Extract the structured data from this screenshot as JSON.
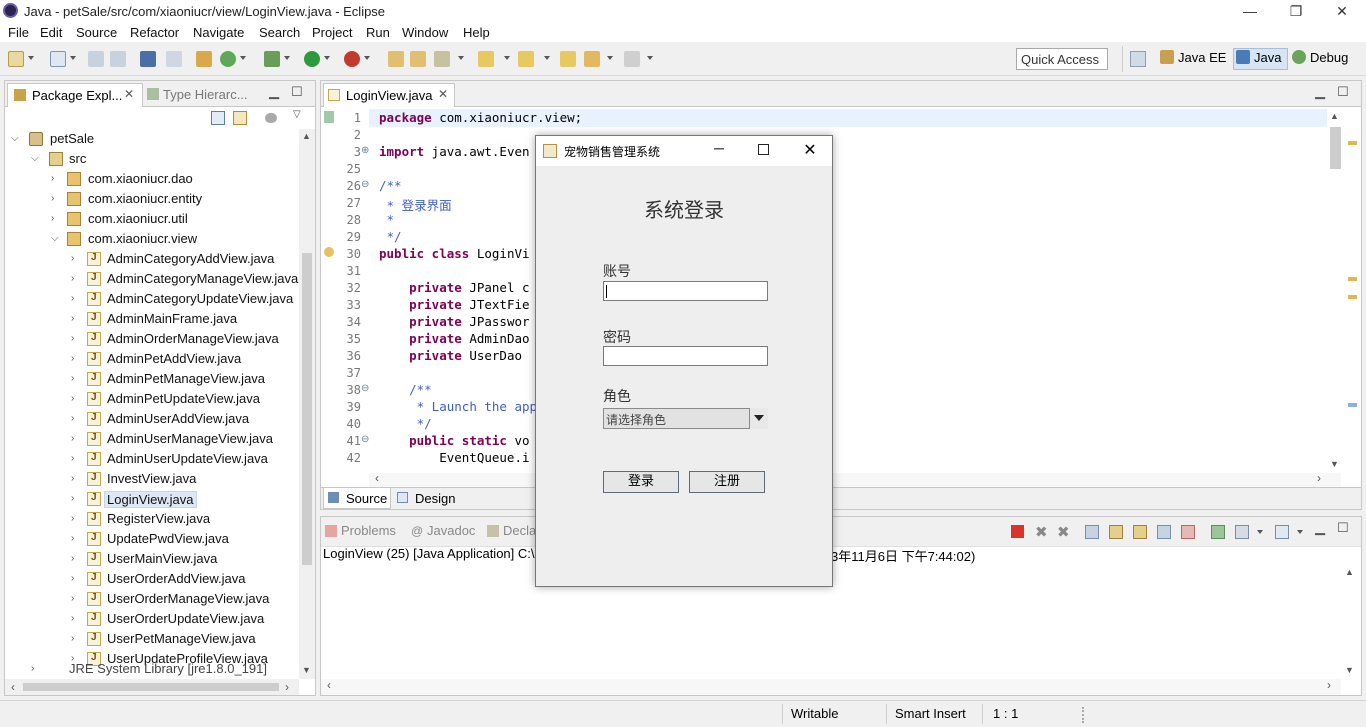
{
  "window": {
    "title": "Java - petSale/src/com/xiaoniucr/view/LoginView.java - Eclipse",
    "minimize": "—",
    "maximize": "❐",
    "close": "✕"
  },
  "menu": [
    "File",
    "Edit",
    "Source",
    "Refactor",
    "Navigate",
    "Search",
    "Project",
    "Run",
    "Window",
    "Help"
  ],
  "toolbar": {
    "quick_access": "Quick Access",
    "perspectives": [
      {
        "label": "Java EE"
      },
      {
        "label": "Java"
      },
      {
        "label": "Debug"
      }
    ]
  },
  "explorer": {
    "tab_active": "Package Expl...",
    "tab_other": "Type Hierarc...",
    "project": "petSale",
    "src": "src",
    "packages": [
      "com.xiaoniucr.dao",
      "com.xiaoniucr.entity",
      "com.xiaoniucr.util",
      "com.xiaoniucr.view"
    ],
    "files": [
      "AdminCategoryAddView.java",
      "AdminCategoryManageView.java",
      "AdminCategoryUpdateView.java",
      "AdminMainFrame.java",
      "AdminOrderManageView.java",
      "AdminPetAddView.java",
      "AdminPetManageView.java",
      "AdminPetUpdateView.java",
      "AdminUserAddView.java",
      "AdminUserManageView.java",
      "AdminUserUpdateView.java",
      "InvestView.java",
      "LoginView.java",
      "RegisterView.java",
      "UpdatePwdView.java",
      "UserMainView.java",
      "UserOrderAddView.java",
      "UserOrderManageView.java",
      "UserOrderUpdateView.java",
      "UserPetManageView.java",
      "UserUpdateProfileView.java"
    ],
    "selected_file": "LoginView.java",
    "partial_row": "JRE System Library [jre1.8.0_191]"
  },
  "editor": {
    "tab": "LoginView.java",
    "lines": [
      {
        "n": "1",
        "parts": [
          [
            "kw",
            "package"
          ],
          [
            "",
            " com.xiaoniucr.view;"
          ]
        ]
      },
      {
        "n": "2",
        "parts": []
      },
      {
        "n": "3",
        "parts": [
          [
            "kw",
            "import"
          ],
          [
            "",
            " java.awt.Even"
          ]
        ]
      },
      {
        "n": "25",
        "parts": []
      },
      {
        "n": "26",
        "parts": [
          [
            "cm",
            "/**"
          ]
        ]
      },
      {
        "n": "27",
        "parts": [
          [
            "cm",
            " * 登录界面"
          ]
        ]
      },
      {
        "n": "28",
        "parts": [
          [
            "cm",
            " *"
          ]
        ]
      },
      {
        "n": "29",
        "parts": [
          [
            "cm",
            " */"
          ]
        ]
      },
      {
        "n": "30",
        "parts": [
          [
            "kw",
            "public class"
          ],
          [
            "",
            " LoginVi"
          ]
        ]
      },
      {
        "n": "31",
        "parts": []
      },
      {
        "n": "32",
        "parts": [
          [
            "",
            "    "
          ],
          [
            "kw",
            "private"
          ],
          [
            "",
            " JPanel c"
          ]
        ]
      },
      {
        "n": "33",
        "parts": [
          [
            "",
            "    "
          ],
          [
            "kw",
            "private"
          ],
          [
            "",
            " JTextFie"
          ]
        ]
      },
      {
        "n": "34",
        "parts": [
          [
            "",
            "    "
          ],
          [
            "kw",
            "private"
          ],
          [
            "",
            " JPasswor"
          ]
        ]
      },
      {
        "n": "35",
        "parts": [
          [
            "",
            "    "
          ],
          [
            "kw",
            "private"
          ],
          [
            "",
            " AdminDao"
          ]
        ]
      },
      {
        "n": "36",
        "parts": [
          [
            "",
            "    "
          ],
          [
            "kw",
            "private"
          ],
          [
            "",
            " UserDao "
          ]
        ]
      },
      {
        "n": "37",
        "parts": []
      },
      {
        "n": "38",
        "parts": [
          [
            "",
            "    "
          ],
          [
            "cm",
            "/**"
          ]
        ]
      },
      {
        "n": "39",
        "parts": [
          [
            "",
            "    "
          ],
          [
            "cm",
            " * Launch the app"
          ]
        ]
      },
      {
        "n": "40",
        "parts": [
          [
            "",
            "    "
          ],
          [
            "cm",
            " */"
          ]
        ]
      },
      {
        "n": "41",
        "parts": [
          [
            "",
            "    "
          ],
          [
            "kw",
            "public static"
          ],
          [
            "",
            " vo"
          ]
        ]
      },
      {
        "n": "42",
        "parts": [
          [
            "",
            "        EventQueue.i"
          ]
        ]
      }
    ],
    "bottom_tabs": [
      "Source",
      "Design"
    ]
  },
  "console": {
    "tabs": [
      "Problems",
      "Javadoc",
      "Decla"
    ],
    "line_left": "LoginView (25) [Java Application] C:\\",
    "line_right": "3年11月6日 下午7:44:02)"
  },
  "dialog": {
    "title": "宠物销售管理系统",
    "heading": "系统登录",
    "account_label": "账号",
    "password_label": "密码",
    "role_label": "角色",
    "role_placeholder": "请选择角色",
    "login_button": "登录",
    "register_button": "注册"
  },
  "status": {
    "writable": "Writable",
    "insert_mode": "Smart Insert",
    "position": "1 : 1"
  },
  "colors": {
    "keyword": "#7f0055",
    "comment": "#3f5fbf",
    "selection": "#dde8f4"
  }
}
